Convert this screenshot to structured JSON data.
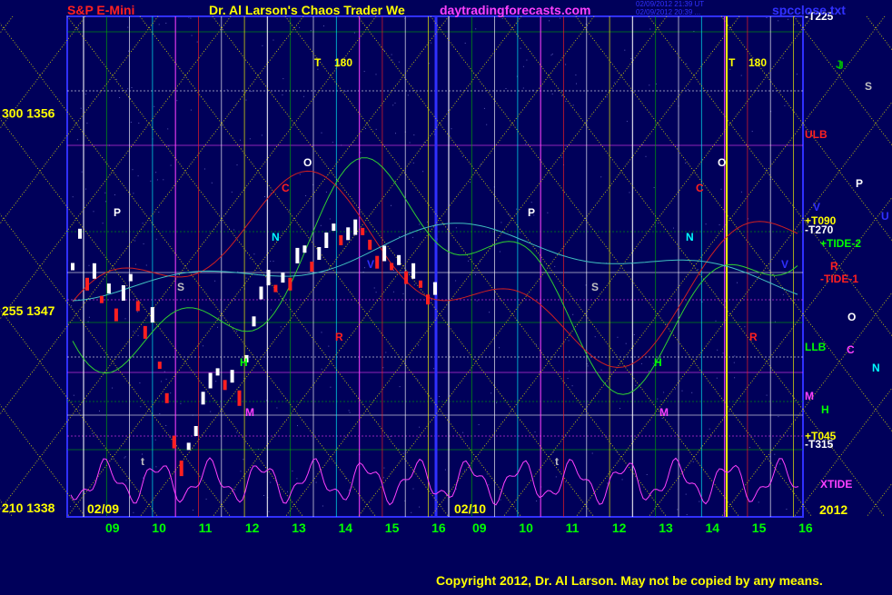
{
  "header": {
    "instrument": "S&P E-Mini",
    "title": "Dr. Al Larson's Chaos Trader We",
    "site": "daytradingforecasts.com",
    "stamp_line1": "02/09/2012 21:39 UT",
    "stamp_line2": "02/09/2012 20:39 ...",
    "file": "spcclose.txt"
  },
  "footer": {
    "copyright": "Copyright 2012, Dr. Al Larson. May not be copied by any means."
  },
  "colors": {
    "background": "#00005a",
    "frame": "#3030ff",
    "grid_green": "#00b000",
    "grid_white": "#ffffff",
    "magenta": "#ff40ff",
    "yellow_dotted": "#e0e000",
    "price_bull": "#ffffff",
    "price_bear": "#ff2020"
  },
  "chart_data": {
    "type": "line",
    "title": "S&P E-Mini",
    "xlabel": "",
    "ylabel": "",
    "ylim": [
      1338,
      1360
    ],
    "y_ticks": [
      {
        "prefix": "300",
        "value": 1356
      },
      {
        "prefix": "255",
        "value": 1347
      },
      {
        "prefix": "210",
        "value": 1338
      }
    ],
    "x_date_labels": [
      {
        "label": "02/09",
        "hour": 8.7
      },
      {
        "label": "02/10",
        "hour": 32.6
      }
    ],
    "x_hour_labels": [
      "09",
      "10",
      "11",
      "12",
      "13",
      "14",
      "15",
      "16",
      "09",
      "10",
      "11",
      "12",
      "13",
      "14",
      "15",
      "16"
    ],
    "year_label": "2012",
    "series": [
      {
        "name": "price",
        "color": "#ffffff",
        "values": [
          {
            "x": 0.0,
            "y": 1349.0
          },
          {
            "x": 0.3,
            "y": 1350.5
          },
          {
            "x": 0.6,
            "y": 1348.2
          },
          {
            "x": 0.9,
            "y": 1348.8
          },
          {
            "x": 1.2,
            "y": 1347.5
          },
          {
            "x": 1.5,
            "y": 1348.0
          },
          {
            "x": 1.8,
            "y": 1346.8
          },
          {
            "x": 2.1,
            "y": 1347.8
          },
          {
            "x": 2.4,
            "y": 1348.5
          },
          {
            "x": 2.7,
            "y": 1347.2
          },
          {
            "x": 3.0,
            "y": 1346.0
          },
          {
            "x": 3.3,
            "y": 1346.8
          },
          {
            "x": 3.6,
            "y": 1344.5
          },
          {
            "x": 3.9,
            "y": 1343.0
          },
          {
            "x": 4.2,
            "y": 1341.0
          },
          {
            "x": 4.5,
            "y": 1339.8
          },
          {
            "x": 4.8,
            "y": 1340.8
          },
          {
            "x": 5.1,
            "y": 1341.5
          },
          {
            "x": 5.4,
            "y": 1343.0
          },
          {
            "x": 5.7,
            "y": 1343.8
          },
          {
            "x": 6.0,
            "y": 1344.2
          },
          {
            "x": 6.3,
            "y": 1343.6
          },
          {
            "x": 6.6,
            "y": 1344.0
          },
          {
            "x": 6.9,
            "y": 1343.0
          },
          {
            "x": 7.2,
            "y": 1344.8
          },
          {
            "x": 7.5,
            "y": 1346.5
          },
          {
            "x": 7.8,
            "y": 1347.8
          },
          {
            "x": 8.1,
            "y": 1348.5
          },
          {
            "x": 8.4,
            "y": 1348.0
          },
          {
            "x": 8.7,
            "y": 1348.5
          },
          {
            "x": 9.0,
            "y": 1348.2
          },
          {
            "x": 9.3,
            "y": 1349.5
          },
          {
            "x": 9.6,
            "y": 1349.8
          },
          {
            "x": 9.9,
            "y": 1349.0
          },
          {
            "x": 10.2,
            "y": 1349.6
          },
          {
            "x": 10.5,
            "y": 1350.2
          },
          {
            "x": 10.8,
            "y": 1350.8
          },
          {
            "x": 11.1,
            "y": 1350.2
          },
          {
            "x": 11.4,
            "y": 1350.5
          },
          {
            "x": 11.7,
            "y": 1350.8
          },
          {
            "x": 12.0,
            "y": 1350.6
          },
          {
            "x": 12.3,
            "y": 1350.0
          },
          {
            "x": 12.6,
            "y": 1349.2
          },
          {
            "x": 12.9,
            "y": 1349.6
          },
          {
            "x": 13.2,
            "y": 1349.0
          },
          {
            "x": 13.5,
            "y": 1349.3
          },
          {
            "x": 13.8,
            "y": 1348.5
          },
          {
            "x": 14.1,
            "y": 1348.8
          },
          {
            "x": 14.4,
            "y": 1348.2
          },
          {
            "x": 14.7,
            "y": 1347.5
          },
          {
            "x": 15.0,
            "y": 1348.0
          }
        ]
      }
    ],
    "annotations": [
      {
        "text": "T",
        "color": "#ffff00"
      },
      {
        "text": "180",
        "color": "#ffff00"
      },
      {
        "text": "O",
        "color": "#ffffff"
      },
      {
        "text": "C",
        "color": "#ff2020"
      },
      {
        "text": "P",
        "color": "#ffffff"
      },
      {
        "text": "S",
        "color": "#c0c0c0"
      },
      {
        "text": "N",
        "color": "#00ffff"
      },
      {
        "text": "R",
        "color": "#ff2020"
      },
      {
        "text": "H",
        "color": "#00ff00"
      },
      {
        "text": "M",
        "color": "#ff40ff"
      },
      {
        "text": "V",
        "color": "#3030ff"
      },
      {
        "text": "J",
        "color": "#00c000"
      },
      {
        "text": "t",
        "color": "#c0c0c0"
      }
    ],
    "right_labels": [
      {
        "text": "-T225",
        "color": "#ffffff"
      },
      {
        "text": "J",
        "color": "#00c000"
      },
      {
        "text": "S",
        "color": "#c0c0c0"
      },
      {
        "text": "ULB",
        "color": "#ff2020"
      },
      {
        "text": "P",
        "color": "#ffffff"
      },
      {
        "text": "V",
        "color": "#3030ff"
      },
      {
        "text": "U",
        "color": "#3030ff"
      },
      {
        "text": "+T090",
        "color": "#ffff00"
      },
      {
        "text": "-T270",
        "color": "#ffffff"
      },
      {
        "text": "+TIDE-2",
        "color": "#00ff00"
      },
      {
        "text": "R",
        "color": "#ff2020"
      },
      {
        "text": "-TIDE-1",
        "color": "#ff2020"
      },
      {
        "text": "O",
        "color": "#ffffff"
      },
      {
        "text": "LLB",
        "color": "#00ff00"
      },
      {
        "text": "C",
        "color": "#ff40ff"
      },
      {
        "text": "N",
        "color": "#00ffff"
      },
      {
        "text": "M",
        "color": "#ff40ff"
      },
      {
        "text": "H",
        "color": "#00ff00"
      },
      {
        "text": "+T045",
        "color": "#ffff00"
      },
      {
        "text": "-T315",
        "color": "#ffffff"
      },
      {
        "text": "XTIDE",
        "color": "#ff40ff"
      }
    ],
    "grid": true,
    "legend": "right"
  }
}
